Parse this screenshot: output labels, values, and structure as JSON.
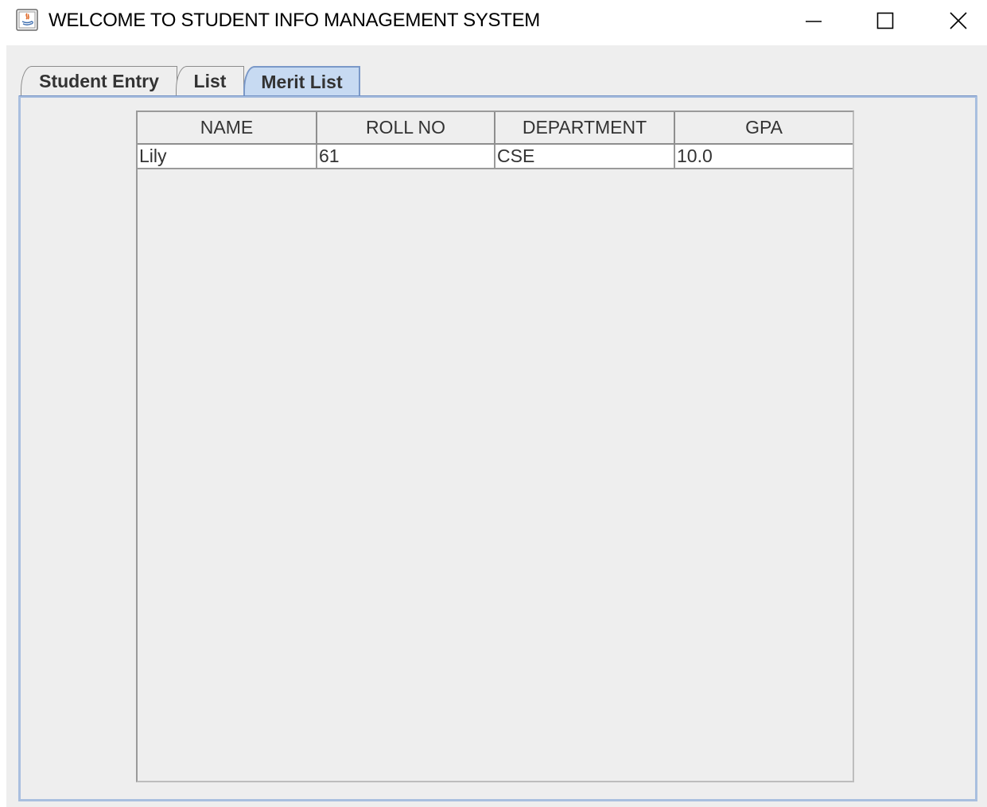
{
  "window": {
    "title": "WELCOME TO STUDENT INFO MANAGEMENT SYSTEM",
    "app_icon": "java-app-icon",
    "controls": {
      "minimize_icon": "minimize-icon",
      "maximize_icon": "maximize-icon",
      "close_icon": "close-icon"
    }
  },
  "tabs": [
    {
      "label": "Student Entry",
      "selected": false
    },
    {
      "label": "List",
      "selected": false
    },
    {
      "label": "Merit List",
      "selected": true
    }
  ],
  "table": {
    "columns": [
      "NAME",
      "ROLL NO",
      "DEPARTMENT",
      "GPA"
    ],
    "rows": [
      [
        "Lily",
        "61",
        "CSE",
        "10.0"
      ]
    ]
  },
  "colors": {
    "selected_tab_bg": "#c7daf2",
    "selected_tab_border": "#7a98c8",
    "panel_border": "#a9bfdf",
    "client_bg": "#eeeeee"
  }
}
